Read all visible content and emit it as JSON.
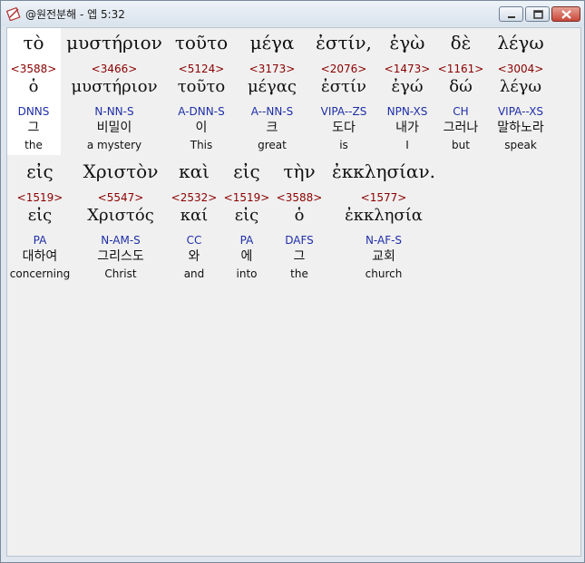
{
  "window": {
    "title": "@원전분해 - 엡 5:32"
  },
  "rows": [
    {
      "words": [
        {
          "greek": "τὸ",
          "strongs": "<3588>",
          "lemma": "ὁ",
          "parsing": "DNNS",
          "korean": "그",
          "english": "the"
        },
        {
          "greek": "μυστήριον",
          "strongs": "<3466>",
          "lemma": "μυστήριον",
          "parsing": "N-NN-S",
          "korean": "비밀이",
          "english": "a mystery"
        },
        {
          "greek": "τοῦτο",
          "strongs": "<5124>",
          "lemma": "τοῦτο",
          "parsing": "A-DNN-S",
          "korean": "이",
          "english": "This"
        },
        {
          "greek": "μέγα",
          "strongs": "<3173>",
          "lemma": "μέγας",
          "parsing": "A--NN-S",
          "korean": "크",
          "english": "great"
        },
        {
          "greek": "ἐστίν,",
          "strongs": "<2076>",
          "lemma": "ἐστίν",
          "parsing": "VIPA--ZS",
          "korean": "도다",
          "english": "is"
        },
        {
          "greek": "ἐγὼ",
          "strongs": "<1473>",
          "lemma": "ἐγώ",
          "parsing": "NPN-XS",
          "korean": "내가",
          "english": "I"
        },
        {
          "greek": "δὲ",
          "strongs": "<1161>",
          "lemma": "δώ",
          "parsing": "CH",
          "korean": "그러나",
          "english": "but"
        },
        {
          "greek": "λέγω",
          "strongs": "<3004>",
          "lemma": "λέγω",
          "parsing": "VIPA--XS",
          "korean": "말하노라",
          "english": "speak"
        }
      ]
    },
    {
      "words": [
        {
          "greek": "εἰς",
          "strongs": "<1519>",
          "lemma": "εἰς",
          "parsing": "PA",
          "korean": "대하여",
          "english": "concerning"
        },
        {
          "greek": "Χριστὸν",
          "strongs": "<5547>",
          "lemma": "Χριστός",
          "parsing": "N-AM-S",
          "korean": "그리스도",
          "english": "Christ"
        },
        {
          "greek": "καὶ",
          "strongs": "<2532>",
          "lemma": "καί",
          "parsing": "CC",
          "korean": "와",
          "english": "and"
        },
        {
          "greek": "εἰς",
          "strongs": "<1519>",
          "lemma": "εἰς",
          "parsing": "PA",
          "korean": "에",
          "english": "into"
        },
        {
          "greek": "τὴν",
          "strongs": "<3588>",
          "lemma": "ὁ",
          "parsing": "DAFS",
          "korean": "그",
          "english": "the"
        },
        {
          "greek": "ἐκκλησίαν.",
          "strongs": "<1577>",
          "lemma": "ἐκκλησία",
          "parsing": "N-AF-S",
          "korean": "교회",
          "english": "church"
        }
      ]
    }
  ]
}
